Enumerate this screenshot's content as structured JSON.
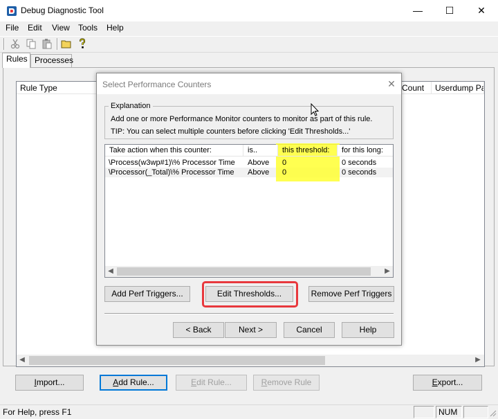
{
  "window": {
    "title": "Debug Diagnostic Tool",
    "icon": "debugdiag-app-icon",
    "controls": {
      "minimize": "—",
      "maximize": "☐",
      "close": "✕"
    }
  },
  "menu": [
    "File",
    "Edit",
    "View",
    "Tools",
    "Help"
  ],
  "toolbar": {
    "icons": [
      "cut-icon",
      "copy-icon",
      "paste-icon",
      "open-folder-icon",
      "help-icon"
    ]
  },
  "tabs": [
    {
      "label": "Rules",
      "active": true
    },
    {
      "label": "Processes",
      "active": false
    }
  ],
  "rules_list": {
    "columns": [
      "Rule Type",
      "Count",
      "Userdump Pat"
    ]
  },
  "main_buttons": {
    "import": {
      "prefix": "",
      "mnemonic": "I",
      "rest": "mport..."
    },
    "add_rule": {
      "prefix": "",
      "mnemonic": "A",
      "rest": "dd Rule..."
    },
    "edit_rule": {
      "prefix": "",
      "mnemonic": "E",
      "rest": "dit Rule..."
    },
    "remove_rule": {
      "prefix": "",
      "mnemonic": "R",
      "rest": "emove Rule"
    },
    "export": {
      "prefix": "",
      "mnemonic": "E",
      "rest": "xport..."
    }
  },
  "statusbar": {
    "text": "For Help, press F1",
    "num": "NUM"
  },
  "dialog": {
    "title": "Select Performance Counters",
    "close": "✕",
    "explanation": {
      "legend": "Explanation",
      "line1": "Add one or more Performance Monitor counters to monitor as part of this rule.",
      "line2": "TIP:  You can select multiple counters before clicking 'Edit Thresholds...'"
    },
    "counters": {
      "columns": [
        "Take action when this counter:",
        "is..",
        "this threshold:",
        "for this long:"
      ],
      "rows": [
        {
          "counter": "\\Process(w3wp#1)\\% Processor Time",
          "is": "Above",
          "threshold": "0",
          "duration": "0 seconds"
        },
        {
          "counter": "\\Processor(_Total)\\% Processor Time",
          "is": "Above",
          "threshold": "0",
          "duration": "0 seconds"
        }
      ]
    },
    "buttons": {
      "add_triggers": "Add Perf Triggers...",
      "edit_thresholds": "Edit Thresholds...",
      "remove_triggers": "Remove Perf Triggers",
      "back": "< Back",
      "next": "Next >",
      "cancel": "Cancel",
      "help": "Help"
    },
    "highlight_color": "#ffff33",
    "annotation_color": "#e8383d"
  }
}
